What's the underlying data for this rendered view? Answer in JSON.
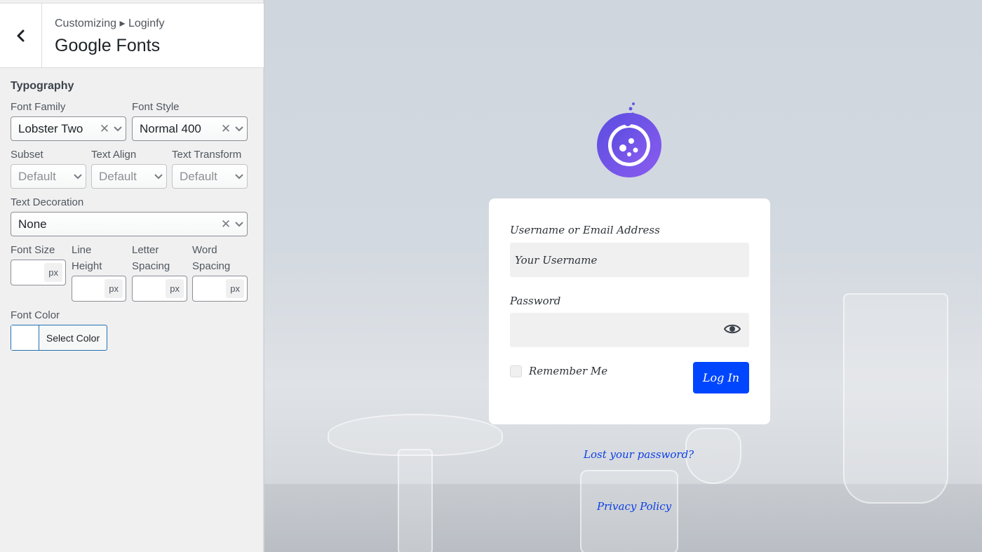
{
  "header": {
    "breadcrumb": "Customizing ▸ Loginfy",
    "title": "Google Fonts"
  },
  "typography": {
    "group_label": "Typography",
    "font_family": {
      "label": "Font Family",
      "value": "Lobster Two"
    },
    "font_style": {
      "label": "Font Style",
      "value": "Normal 400"
    },
    "subset": {
      "label": "Subset",
      "value": "Default"
    },
    "text_align": {
      "label": "Text Align",
      "value": "Default"
    },
    "text_transform": {
      "label": "Text Transform",
      "value": "Default"
    },
    "text_decoration": {
      "label": "Text Decoration",
      "value": "None"
    },
    "font_size": {
      "label": "Font Size",
      "unit": "px"
    },
    "line_height": {
      "label_line1": "Line",
      "label_line2": "Height",
      "unit": "px"
    },
    "letter_spacing": {
      "label_line1": "Letter",
      "label_line2": "Spacing",
      "unit": "px"
    },
    "word_spacing": {
      "label_line1": "Word",
      "label_line2": "Spacing",
      "unit": "px"
    },
    "font_color": {
      "label": "Font Color",
      "button": "Select Color"
    },
    "clear_glyph": "✕"
  },
  "login": {
    "username_label": "Username or Email Address",
    "username_placeholder": "Your Username",
    "password_label": "Password",
    "remember_label": "Remember Me",
    "login_button": "Log In",
    "lost_password": "Lost your password?",
    "privacy_policy": "Privacy Policy"
  },
  "colors": {
    "accent_button": "#0046ff",
    "link": "#0b3fe6",
    "logo_gradient": [
      "#5b4de0",
      "#8a5cf0"
    ]
  },
  "icons": [
    "back-chevron-icon",
    "clear-icon",
    "chevron-down-icon",
    "eye-icon",
    "logo-flask-icon"
  ]
}
